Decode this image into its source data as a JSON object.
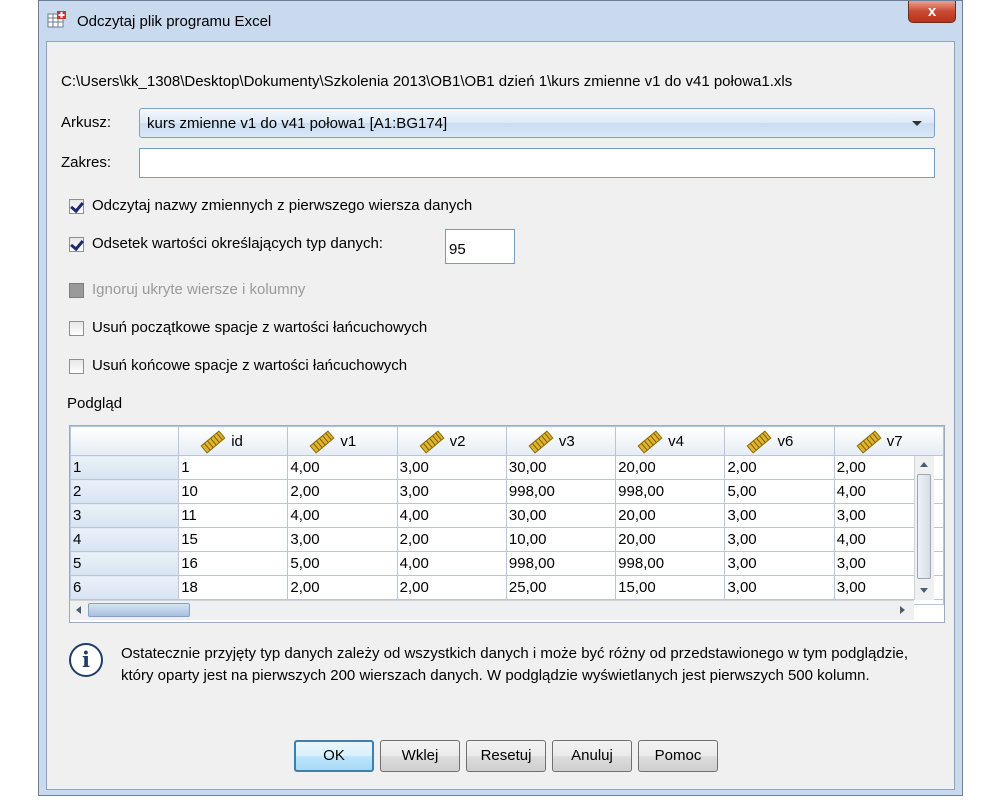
{
  "window": {
    "title": "Odczytaj plik programu Excel",
    "close_label": "x"
  },
  "file_path": "C:\\Users\\kk_1308\\Desktop\\Dokumenty\\Szkolenia 2013\\OB1\\OB1 dzień 1\\kurs zmienne v1 do v41 połowa1.xls",
  "sheet": {
    "label": "Arkusz:",
    "value": "kurs zmienne v1 do v41 połowa1 [A1:BG174]"
  },
  "range": {
    "label": "Zakres:",
    "value": ""
  },
  "options": {
    "read_names": {
      "label": "Odczytaj nazwy zmiennych z pierwszego wiersza danych",
      "checked": true
    },
    "percent": {
      "label": "Odsetek wartości określających typ danych:",
      "checked": true,
      "value": "95"
    },
    "ignore_hidden": {
      "label": "Ignoruj ukryte wiersze i kolumny",
      "checked": false,
      "disabled": true
    },
    "remove_leading": {
      "label": "Usuń początkowe spacje z wartości łańcuchowych",
      "checked": false
    },
    "remove_trailing": {
      "label": "Usuń końcowe spacje z wartości łańcuchowych",
      "checked": false
    }
  },
  "preview": {
    "label": "Podgląd",
    "columns": [
      "id",
      "v1",
      "v2",
      "v3",
      "v4",
      "v6",
      "v7"
    ],
    "rows": [
      [
        "1",
        "1",
        "4,00",
        "3,00",
        "30,00",
        "20,00",
        "2,00",
        "2,00"
      ],
      [
        "2",
        "10",
        "2,00",
        "3,00",
        "998,00",
        "998,00",
        "5,00",
        "4,00"
      ],
      [
        "3",
        "11",
        "4,00",
        "4,00",
        "30,00",
        "20,00",
        "3,00",
        "3,00"
      ],
      [
        "4",
        "15",
        "3,00",
        "2,00",
        "10,00",
        "20,00",
        "3,00",
        "4,00"
      ],
      [
        "5",
        "16",
        "5,00",
        "4,00",
        "998,00",
        "998,00",
        "3,00",
        "3,00"
      ],
      [
        "6",
        "18",
        "2,00",
        "2,00",
        "25,00",
        "15,00",
        "3,00",
        "3,00"
      ]
    ]
  },
  "info": {
    "icon": "info-icon",
    "text": "Ostatecznie przyjęty typ danych zależy od wszystkich danych i może być różny od przedstawionego w tym podglądzie, który oparty jest na pierwszych 200 wierszach danych. W podglądzie wyświetlanych jest pierwszych 500 kolumn."
  },
  "buttons": {
    "ok": "OK",
    "paste": "Wklej",
    "reset": "Resetuj",
    "cancel": "Anuluj",
    "help": "Pomoc"
  },
  "colors": {
    "frame": "#c9d9ee",
    "close_button": "#c74a32",
    "default_button_border": "#3c7fb1"
  }
}
